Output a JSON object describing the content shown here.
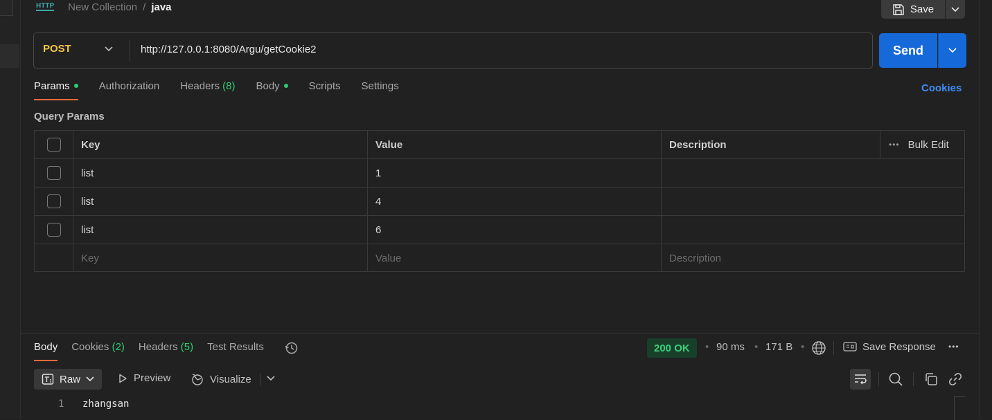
{
  "breadcrumb": {
    "http_badge": "HTTP",
    "collection": "New Collection",
    "separator": "/",
    "request_name": "java"
  },
  "save": {
    "label": "Save"
  },
  "request": {
    "method": "POST",
    "url": "http://127.0.0.1:8080/Argu/getCookie2",
    "send_label": "Send"
  },
  "request_tabs": {
    "params": "Params",
    "authorization": "Authorization",
    "headers": "Headers",
    "headers_count": "(8)",
    "body": "Body",
    "scripts": "Scripts",
    "settings": "Settings",
    "cookies": "Cookies"
  },
  "query_params": {
    "title": "Query Params",
    "columns": {
      "key": "Key",
      "value": "Value",
      "description": "Description",
      "bulk_edit": "Bulk Edit"
    },
    "rows": [
      {
        "key": "list",
        "value": "1",
        "description": ""
      },
      {
        "key": "list",
        "value": "4",
        "description": ""
      },
      {
        "key": "list",
        "value": "6",
        "description": ""
      }
    ],
    "placeholders": {
      "key": "Key",
      "value": "Value",
      "description": "Description"
    }
  },
  "response": {
    "tabs": {
      "body": "Body",
      "cookies": "Cookies",
      "cookies_count": "(2)",
      "headers": "Headers",
      "headers_count": "(5)",
      "test_results": "Test Results"
    },
    "status": "200 OK",
    "time": "90 ms",
    "size": "171 B",
    "save_response": "Save Response",
    "view": {
      "raw": "Raw",
      "preview": "Preview",
      "visualize": "Visualize"
    },
    "lines": [
      {
        "number": "1",
        "text": "zhangsan"
      }
    ]
  },
  "colors": {
    "accent_orange": "#f26b3a",
    "send_blue": "#1669d9",
    "method_yellow": "#f4c74a",
    "status_green": "#3fd07a",
    "dot_green": "#2ecc71"
  }
}
